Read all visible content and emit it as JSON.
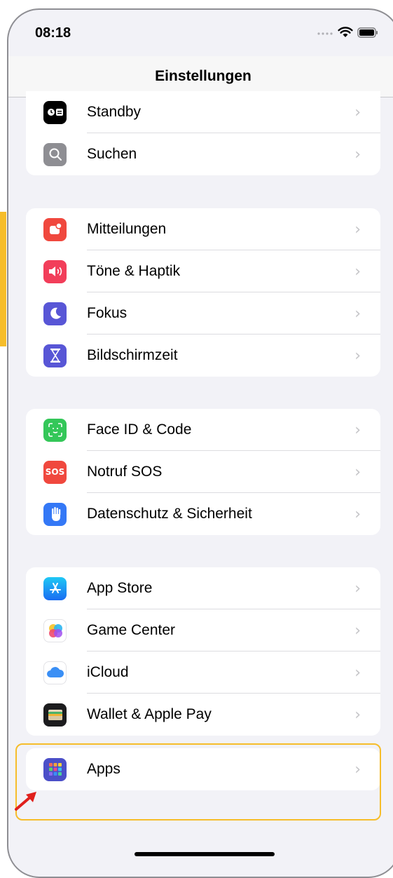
{
  "status_bar": {
    "time": "08:18"
  },
  "header": {
    "title": "Einstellungen"
  },
  "groups": [
    {
      "items": [
        {
          "label": "Standby",
          "icon": "standby-icon",
          "color": "#000000"
        },
        {
          "label": "Suchen",
          "icon": "search-icon",
          "color": "#8e8e93"
        }
      ]
    },
    {
      "items": [
        {
          "label": "Mitteilungen",
          "icon": "notifications-icon",
          "color": "#f0483e"
        },
        {
          "label": "Töne & Haptik",
          "icon": "sound-icon",
          "color": "#f23e5a"
        },
        {
          "label": "Fokus",
          "icon": "focus-moon-icon",
          "color": "#5856d6"
        },
        {
          "label": "Bildschirmzeit",
          "icon": "screen-time-hourglass-icon",
          "color": "#5856d6"
        }
      ]
    },
    {
      "items": [
        {
          "label": "Face ID & Code",
          "icon": "face-id-icon",
          "color": "#34c759"
        },
        {
          "label": "Notruf SOS",
          "icon": "sos-icon",
          "color": "#f0483e",
          "icon_text": "SOS"
        },
        {
          "label": "Datenschutz & Sicherheit",
          "icon": "privacy-hand-icon",
          "color": "#3478f6"
        }
      ]
    },
    {
      "items": [
        {
          "label": "App Store",
          "icon": "app-store-icon",
          "color": "#1e8cf5"
        },
        {
          "label": "Game Center",
          "icon": "game-center-icon",
          "color": "#ffffff"
        },
        {
          "label": "iCloud",
          "icon": "icloud-icon",
          "color": "#ffffff"
        },
        {
          "label": "Wallet & Apple Pay",
          "icon": "wallet-icon",
          "color": "#1c1c1e"
        }
      ]
    },
    {
      "items": [
        {
          "label": "Apps",
          "icon": "apps-grid-icon",
          "color": "#4b4fc8"
        }
      ]
    }
  ],
  "chevron": "›",
  "colors": {
    "highlight": "#f6bd2a",
    "arrow": "#e0201c",
    "background": "#f2f2f7"
  }
}
